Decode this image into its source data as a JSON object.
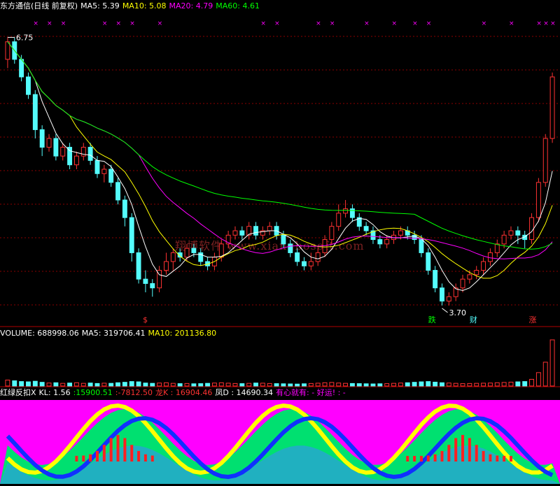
{
  "price_header": {
    "stock": "东方通信(日线 前复权)",
    "ma5": "MA5: 5.39",
    "ma10": "MA10: 5.08",
    "ma20": "MA20: 4.79",
    "ma60": "MA60: 4.61"
  },
  "volume_header": {
    "volume": "VOLUME: 688998.06",
    "ma5": "MA5: 319706.41",
    "ma10": "MA10: 201136.80"
  },
  "indicator_header": {
    "name": "红绿反扣X",
    "kl": "KL: 1.56",
    "v1": ":15900.51",
    "v2": ":-7812.50",
    "long_k": "龙K : 16904.46",
    "feng_d": "凤D : 14690.34",
    "motto": "有心就有: - 好运! : -"
  },
  "annotations": {
    "high_price": "6.75",
    "low_price": "3.70",
    "marker_die": "跌",
    "marker_cai": "财",
    "marker_zhang": "涨",
    "marker_dollar": "$"
  },
  "watermark": "翔博软件 www.xiangbosoft.com",
  "colors": {
    "ma5": "#ffffff",
    "ma10": "#ffff00",
    "ma20": "#ff00ff",
    "ma60": "#00ff00",
    "up": "#ff3232",
    "down": "#54fcfc",
    "grid": "#8b0000"
  },
  "chart_data": [
    {
      "type": "candlestick",
      "title": "东方通信(日线 前复权)",
      "ylim": [
        3.5,
        7.0
      ],
      "annotations": {
        "max": 6.75,
        "min": 3.7
      },
      "candles": [
        [
          6.5,
          6.7,
          6.4,
          6.75
        ],
        [
          6.7,
          6.5,
          6.45,
          6.75
        ],
        [
          6.5,
          6.3,
          6.25,
          6.55
        ],
        [
          6.3,
          6.1,
          6.05,
          6.35
        ],
        [
          6.1,
          5.7,
          5.6,
          6.15
        ],
        [
          5.7,
          5.5,
          5.4,
          5.75
        ],
        [
          5.5,
          5.6,
          5.45,
          5.65
        ],
        [
          5.6,
          5.4,
          5.35,
          5.65
        ],
        [
          5.4,
          5.5,
          5.35,
          5.55
        ],
        [
          5.5,
          5.3,
          5.25,
          5.55
        ],
        [
          5.3,
          5.4,
          5.25,
          5.45
        ],
        [
          5.4,
          5.5,
          5.35,
          5.55
        ],
        [
          5.5,
          5.35,
          5.3,
          5.55
        ],
        [
          5.35,
          5.2,
          5.15,
          5.4
        ],
        [
          5.2,
          5.25,
          5.1,
          5.3
        ],
        [
          5.25,
          5.1,
          5.05,
          5.3
        ],
        [
          5.1,
          4.9,
          4.85,
          5.15
        ],
        [
          4.9,
          4.7,
          4.6,
          4.95
        ],
        [
          4.7,
          4.3,
          4.2,
          4.75
        ],
        [
          4.3,
          4.0,
          3.95,
          4.35
        ],
        [
          4.0,
          3.95,
          3.85,
          4.1
        ],
        [
          3.95,
          3.9,
          3.8,
          4.0
        ],
        [
          3.9,
          4.1,
          3.85,
          4.15
        ],
        [
          4.1,
          4.2,
          4.05,
          4.3
        ],
        [
          4.2,
          4.3,
          4.1,
          4.35
        ],
        [
          4.3,
          4.25,
          4.2,
          4.35
        ],
        [
          4.25,
          4.35,
          4.2,
          4.4
        ],
        [
          4.35,
          4.3,
          4.25,
          4.4
        ],
        [
          4.3,
          4.2,
          4.15,
          4.35
        ],
        [
          4.2,
          4.15,
          4.1,
          4.25
        ],
        [
          4.15,
          4.25,
          4.1,
          4.3
        ],
        [
          4.25,
          4.4,
          4.2,
          4.45
        ],
        [
          4.4,
          4.5,
          4.35,
          4.55
        ],
        [
          4.5,
          4.55,
          4.45,
          4.6
        ],
        [
          4.55,
          4.5,
          4.45,
          4.6
        ],
        [
          4.5,
          4.6,
          4.45,
          4.65
        ],
        [
          4.6,
          4.5,
          4.45,
          4.65
        ],
        [
          4.5,
          4.55,
          4.45,
          4.6
        ],
        [
          4.55,
          4.6,
          4.5,
          4.65
        ],
        [
          4.6,
          4.5,
          4.45,
          4.65
        ],
        [
          4.5,
          4.4,
          4.35,
          4.55
        ],
        [
          4.4,
          4.3,
          4.25,
          4.45
        ],
        [
          4.3,
          4.2,
          4.15,
          4.35
        ],
        [
          4.2,
          4.15,
          4.1,
          4.25
        ],
        [
          4.15,
          4.2,
          4.1,
          4.3
        ],
        [
          4.2,
          4.3,
          4.15,
          4.35
        ],
        [
          4.3,
          4.45,
          4.25,
          4.5
        ],
        [
          4.45,
          4.6,
          4.4,
          4.65
        ],
        [
          4.6,
          4.75,
          4.55,
          4.85
        ],
        [
          4.75,
          4.8,
          4.7,
          4.9
        ],
        [
          4.8,
          4.7,
          4.65,
          4.85
        ],
        [
          4.7,
          4.6,
          4.55,
          4.75
        ],
        [
          4.6,
          4.55,
          4.5,
          4.65
        ],
        [
          4.55,
          4.45,
          4.4,
          4.6
        ],
        [
          4.45,
          4.4,
          4.35,
          4.5
        ],
        [
          4.4,
          4.45,
          4.35,
          4.5
        ],
        [
          4.45,
          4.5,
          4.4,
          4.55
        ],
        [
          4.5,
          4.55,
          4.45,
          4.6
        ],
        [
          4.55,
          4.5,
          4.45,
          4.6
        ],
        [
          4.5,
          4.45,
          4.4,
          4.55
        ],
        [
          4.45,
          4.3,
          4.25,
          4.5
        ],
        [
          4.3,
          4.1,
          4.05,
          4.35
        ],
        [
          4.1,
          3.9,
          3.85,
          4.15
        ],
        [
          3.9,
          3.75,
          3.7,
          3.95
        ],
        [
          3.75,
          3.8,
          3.7,
          3.85
        ],
        [
          3.8,
          3.9,
          3.75,
          3.95
        ],
        [
          3.9,
          4.0,
          3.85,
          4.05
        ],
        [
          4.0,
          4.05,
          3.95,
          4.1
        ],
        [
          4.05,
          4.1,
          4.0,
          4.15
        ],
        [
          4.1,
          4.2,
          4.05,
          4.25
        ],
        [
          4.2,
          4.3,
          4.15,
          4.35
        ],
        [
          4.3,
          4.4,
          4.25,
          4.45
        ],
        [
          4.4,
          4.5,
          4.35,
          4.55
        ],
        [
          4.5,
          4.55,
          4.45,
          4.6
        ],
        [
          4.55,
          4.5,
          4.4,
          4.6
        ],
        [
          4.5,
          4.45,
          4.35,
          4.55
        ],
        [
          4.45,
          4.7,
          4.4,
          4.75
        ],
        [
          4.7,
          5.1,
          4.65,
          5.15
        ],
        [
          5.1,
          5.6,
          5.05,
          5.65
        ],
        [
          5.6,
          6.3,
          5.55,
          6.35
        ]
      ]
    },
    {
      "type": "bar",
      "title": "VOLUME",
      "values": [
        40,
        35,
        30,
        28,
        32,
        25,
        20,
        22,
        18,
        20,
        22,
        18,
        20,
        17,
        19,
        18,
        22,
        25,
        30,
        28,
        20,
        18,
        20,
        22,
        18,
        16,
        17,
        15,
        16,
        18,
        20,
        22,
        19,
        17,
        16,
        18,
        20,
        19,
        17,
        16,
        15,
        14,
        13,
        15,
        17,
        19,
        22,
        24,
        20,
        18,
        17,
        16,
        15,
        14,
        15,
        16,
        18,
        20,
        22,
        25,
        28,
        30,
        26,
        22,
        20,
        18,
        16,
        17,
        18,
        19,
        20,
        22,
        24,
        26,
        28,
        30,
        45,
        90,
        160,
        310
      ]
    }
  ]
}
